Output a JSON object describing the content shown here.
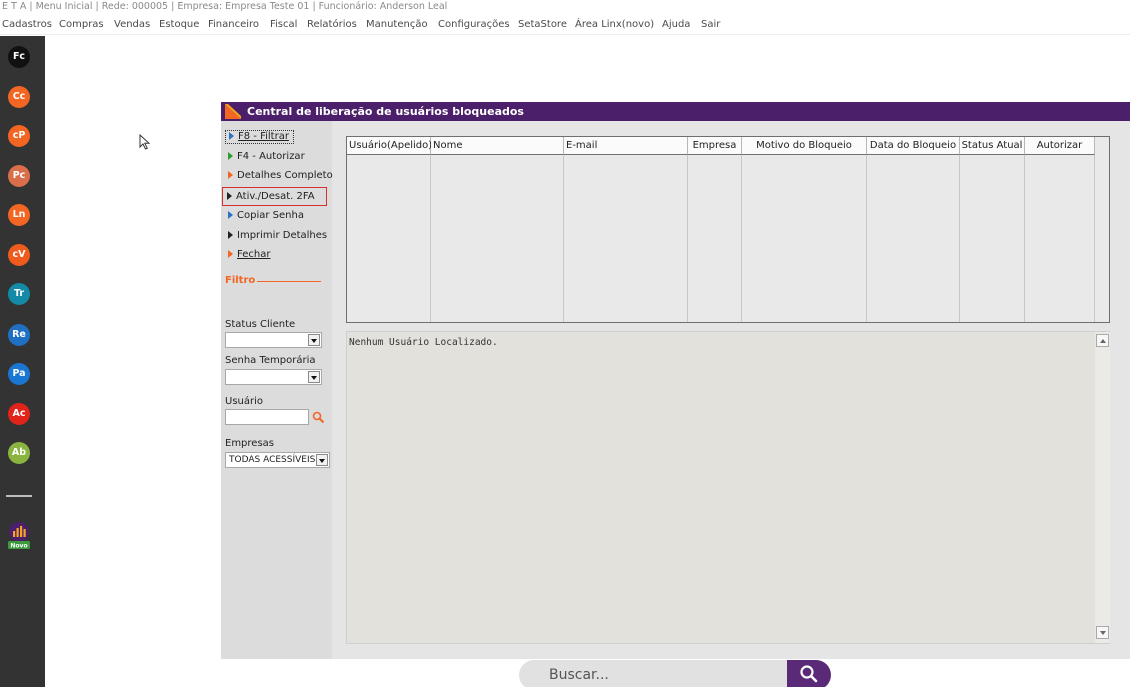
{
  "titlebar": {
    "text": "E T A | Menu Inicial | Rede: 000005 | Empresa: Empresa Teste  01 | Funcionário: Anderson Leal"
  },
  "menu": {
    "items": [
      "Cadastros",
      "Compras",
      "Vendas",
      "Estoque",
      "Financeiro",
      "Fiscal",
      "Relatórios",
      "Manutenção",
      "Configurações",
      "SetaStore",
      "Área Linx(novo)",
      "Ajuda",
      "Sair"
    ]
  },
  "apps": {
    "items": [
      {
        "abbr": "Fc",
        "color": "#111111"
      },
      {
        "abbr": "Cc",
        "color": "#f26522"
      },
      {
        "abbr": "cP",
        "color": "#f26522"
      },
      {
        "abbr": "Pc",
        "color": "#d86f4a"
      },
      {
        "abbr": "Ln",
        "color": "#f26522"
      },
      {
        "abbr": "cV",
        "color": "#ef5a1d"
      },
      {
        "abbr": "Tr",
        "color": "#138aa6"
      },
      {
        "abbr": "Re",
        "color": "#1f6fc2"
      },
      {
        "abbr": "Pa",
        "color": "#1976d2"
      },
      {
        "abbr": "Ac",
        "color": "#e2231a"
      },
      {
        "abbr": "Ab",
        "color": "#8ab43f"
      }
    ],
    "new_badge": "Novo"
  },
  "window": {
    "title": "Central de liberação de usuários bloqueados"
  },
  "actions": {
    "filter": "F8 - Filtrar",
    "authorize": "F4 - Autorizar",
    "details": "Detalhes Completo",
    "toggle_2fa": "Ativ./Desat. 2FA",
    "copy_password": "Copiar Senha",
    "print_details": "Imprimir Detalhes",
    "close": "Fechar"
  },
  "filters": {
    "section_title": "Filtro",
    "status_label": "Status Cliente",
    "status_value": "",
    "temp_password_label": "Senha Temporária",
    "temp_password_value": "",
    "user_label": "Usuário",
    "user_value": "",
    "companies_label": "Empresas",
    "companies_value": "TODAS ACESSÍVEIS"
  },
  "table": {
    "columns": [
      "Usuário(Apelido)",
      "Nome",
      "E-mail",
      "Empresa",
      "Motivo do Bloqueio",
      "Data do Bloqueio",
      "Status Atual",
      "Autorizar"
    ],
    "rows": []
  },
  "message": "Nenhum Usuário Localizado.",
  "search": {
    "placeholder": "Buscar..."
  },
  "colors": {
    "brand": "#4b1f6a",
    "accent": "#f26522"
  }
}
